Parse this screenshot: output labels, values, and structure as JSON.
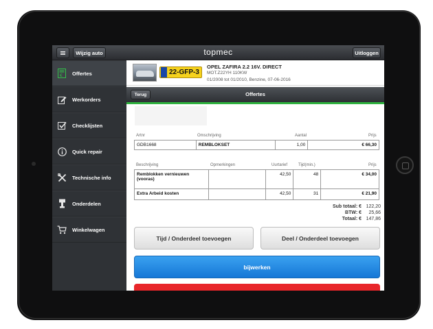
{
  "app": {
    "title": "topmec"
  },
  "topbar": {
    "wijzig_label": "Wijzig auto",
    "logout_label": "Uitloggen"
  },
  "sidebar": {
    "items": [
      {
        "label": "Offertes",
        "icon": "document-euro-icon",
        "active": true
      },
      {
        "label": "Werkorders",
        "icon": "edit-icon",
        "active": false
      },
      {
        "label": "Checklijsten",
        "icon": "checkbox-icon",
        "active": false
      },
      {
        "label": "Quick repair",
        "icon": "info-icon",
        "active": false
      },
      {
        "label": "Technische info",
        "icon": "tools-icon",
        "active": false
      },
      {
        "label": "Onderdelen",
        "icon": "parts-icon",
        "active": false
      },
      {
        "label": "Winkelwagen",
        "icon": "cart-icon",
        "active": false
      }
    ]
  },
  "car": {
    "plate": "22-GFP-3",
    "model": "OPEL ZAFIRA 2.2 16V. DIRECT",
    "engine": "MOT.Z22YH 110KW",
    "dates": "01/2008 tot 01/2010, Benzine, 07-06-2016"
  },
  "nav": {
    "back_label": "Terug",
    "title": "Offertes"
  },
  "parts_table": {
    "headers": {
      "artnr": "Artnr",
      "omschrijving": "Omschrijving",
      "aantal": "Aantal",
      "prijs": "Prijs"
    },
    "rows": [
      {
        "artnr": "GDB1668",
        "omschrijving": "REMBLOKSET",
        "aantal": "1,00",
        "prijs": "€ 66,30"
      }
    ]
  },
  "labor_table": {
    "headers": {
      "beschrijving": "Beschrijving",
      "opmerkingen": "Opmerkingen",
      "uurtarief": "Uurtarief",
      "tijd": "Tijd(min.)",
      "prijs": "Prijs"
    },
    "rows": [
      {
        "beschrijving": "Remblokken vernieuwen (vooras)",
        "opmerkingen": "",
        "uurtarief": "42,50",
        "tijd": "48",
        "prijs": "€ 34,00"
      },
      {
        "beschrijving": "Extra Arbeid kosten",
        "opmerkingen": "",
        "uurtarief": "42,50",
        "tijd": "31",
        "prijs": "€ 21,90"
      }
    ]
  },
  "totals": {
    "sub_label": "Sub totaal: €",
    "sub_value": "122,20",
    "btw_label": "BTW: €",
    "btw_value": "25,66",
    "total_label": "Totaal: €",
    "total_value": "147,86"
  },
  "buttons": {
    "tijd_label": "Tijd / Onderdeel toevoegen",
    "deel_label": "Deel / Onderdeel toevoegen",
    "update_label": "bijwerken"
  },
  "colors": {
    "accent_green": "#2fb23f",
    "update_blue": "#1e88e5",
    "delete_red": "#e8262a",
    "plate_yellow": "#f6d21c"
  }
}
